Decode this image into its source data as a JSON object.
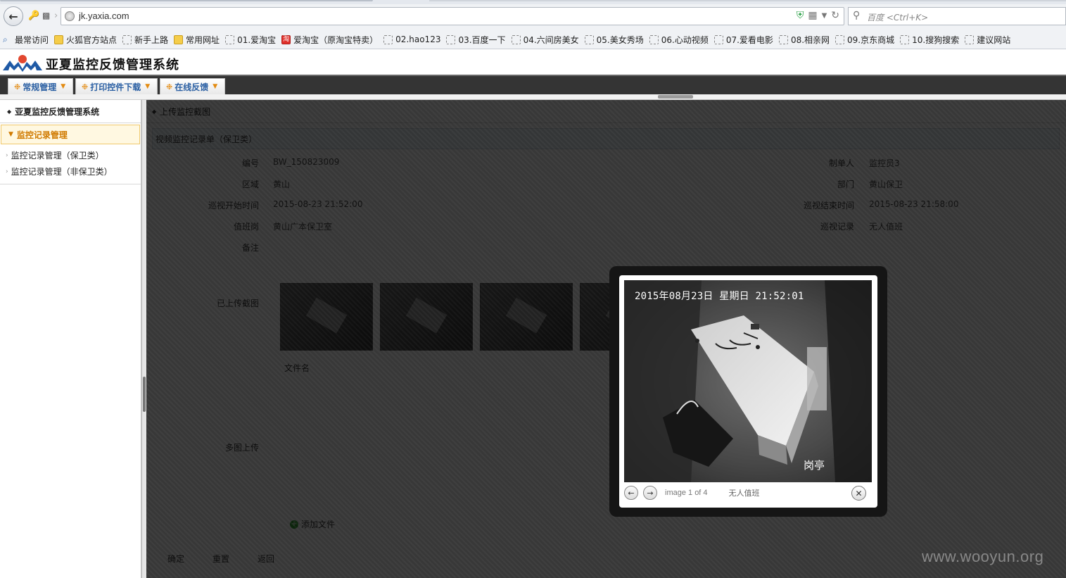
{
  "browser": {
    "url": "jk.yaxia.com",
    "search_placeholder": "百度 <Ctrl+K>",
    "bookmarks": [
      {
        "label": "最常访问",
        "icon": "search-icon"
      },
      {
        "label": "火狐官方站点",
        "icon": "folder-icon"
      },
      {
        "label": "新手上路",
        "icon": "page-icon"
      },
      {
        "label": "常用网址",
        "icon": "folder-icon"
      },
      {
        "label": "01.爱淘宝",
        "icon": "page-icon"
      },
      {
        "label": "爱淘宝（原淘宝特卖）",
        "icon": "taobao-icon"
      },
      {
        "label": "02.hao123",
        "icon": "page-icon"
      },
      {
        "label": "03.百度一下",
        "icon": "page-icon"
      },
      {
        "label": "04.六间房美女",
        "icon": "page-icon"
      },
      {
        "label": "05.美女秀场",
        "icon": "page-icon"
      },
      {
        "label": "06.心动视频",
        "icon": "page-icon"
      },
      {
        "label": "07.爱看电影",
        "icon": "page-icon"
      },
      {
        "label": "08.相亲网",
        "icon": "page-icon"
      },
      {
        "label": "09.京东商城",
        "icon": "page-icon"
      },
      {
        "label": "10.搜狗搜索",
        "icon": "page-icon"
      },
      {
        "label": "建议网站",
        "icon": "page-icon"
      }
    ]
  },
  "app": {
    "title": "亚夏监控反馈管理系统",
    "menus": [
      "常规管理",
      "打印控件下载",
      "在线反馈"
    ]
  },
  "sidebar": {
    "title": "亚夏监控反馈管理系统",
    "group": "监控记录管理",
    "items": [
      "监控记录管理（保卫类）",
      "监控记录管理（非保卫类）"
    ]
  },
  "content": {
    "title": "上传监控截图",
    "subtitle": "视频监控记录单（保卫类）",
    "fields": {
      "code_label": "编号",
      "code_value": "BW_150823009",
      "maker_label": "制单人",
      "maker_value": "监控员3",
      "area_label": "区域",
      "area_value": "黄山",
      "dept_label": "部门",
      "dept_value": "黄山保卫",
      "start_label": "巡视开始时间",
      "start_value": "2015-08-23 21:52:00",
      "end_label": "巡视结束时间",
      "end_value": "2015-08-23 21:58:00",
      "duty_label": "值班岗",
      "duty_value": "黄山广本保卫室",
      "record_label": "巡视记录",
      "record_value": "无人值班",
      "remark_label": "备注",
      "uploaded_label": "已上传截图",
      "multi_label": "多图上传"
    },
    "file_text": "文件名",
    "add_file": "添加文件",
    "buttons": [
      "确定",
      "重置",
      "返回"
    ]
  },
  "lightbox": {
    "timestamp": "2015年08月23日 星期日 21:52:01",
    "location": "岗亭",
    "counter": "image 1 of 4",
    "caption": "无人值班"
  },
  "watermark": "www.wooyun.org"
}
